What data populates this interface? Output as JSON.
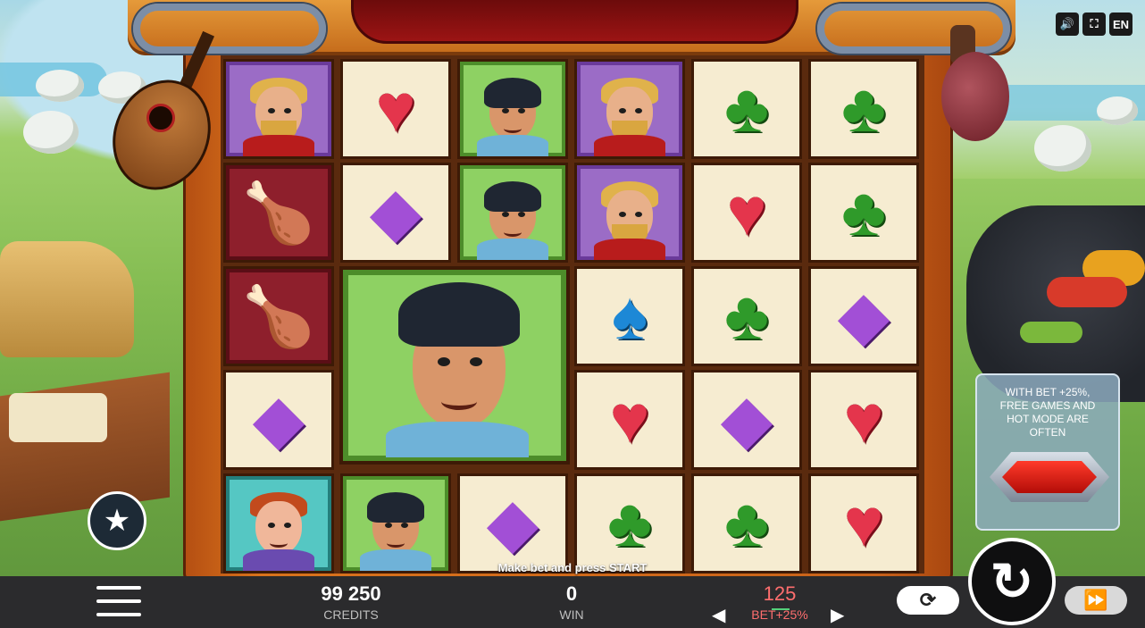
{
  "top_icons": {
    "sound": "🔊",
    "fullscreen": "⛶",
    "language": "EN"
  },
  "grid": {
    "symbols": {
      "heart": "♥",
      "club": "♣",
      "spade": "♠",
      "diamond": "◆",
      "turkey": "🍗"
    }
  },
  "promo": {
    "text": "WITH BET +25%, FREE GAMES AND HOT MODE ARE OFTEN",
    "toggle_state": "on"
  },
  "hint": "Make bet and press START",
  "bottom_bar": {
    "credits_value": "99 250",
    "credits_label": "CREDITS",
    "win_value": "0",
    "win_label": "WIN",
    "bet_value": "125",
    "bet_label": "BET+25%",
    "prev_arrow": "◀",
    "next_arrow": "▶",
    "autoplay_glyph": "⟳",
    "turbo_glyph": "⏩",
    "spin_glyph": "↻",
    "favorite_glyph": "★"
  },
  "colors": {
    "accent_bet": "#ff6e6e",
    "frame": "#c9621a",
    "panel": "#2b2b2d"
  }
}
